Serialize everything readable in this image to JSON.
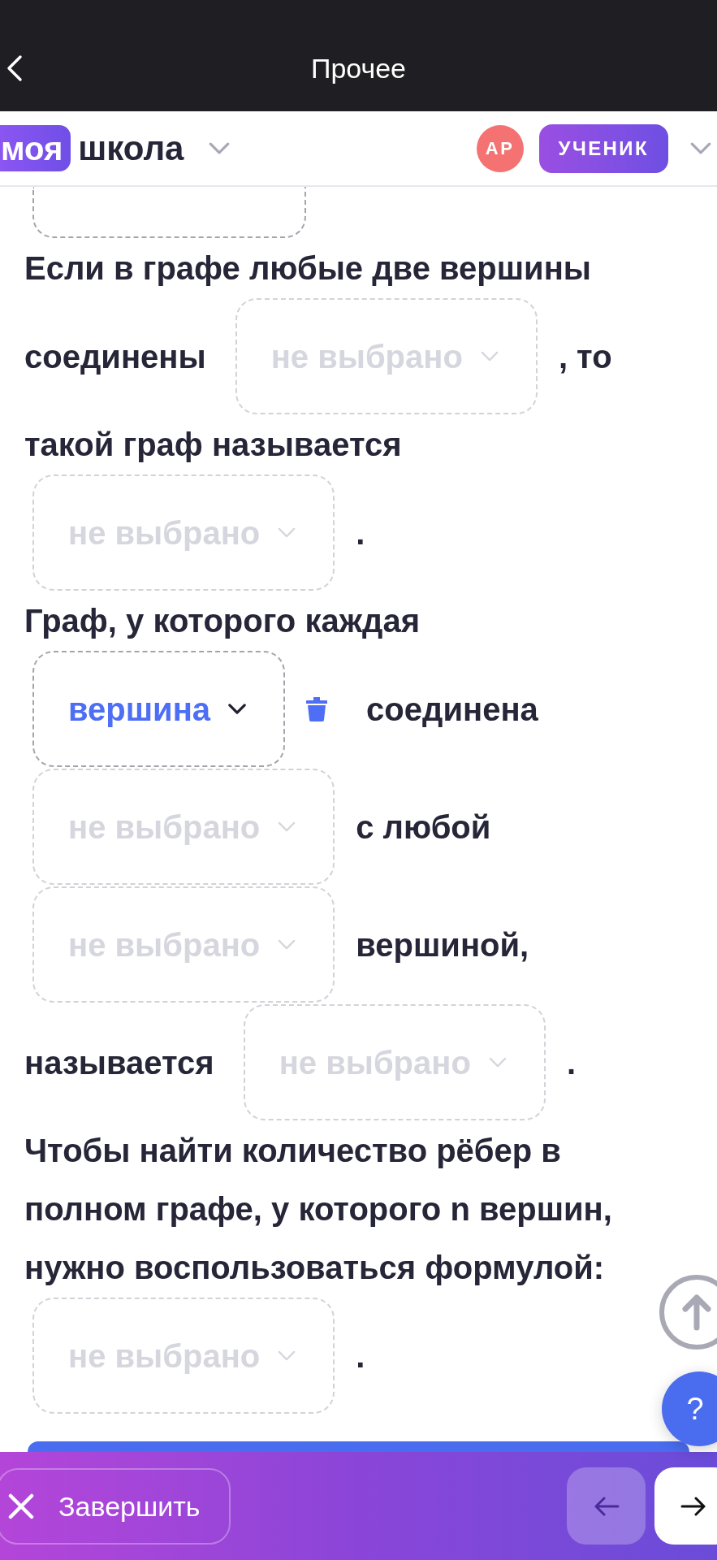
{
  "header": {
    "title": "Прочее"
  },
  "nav": {
    "logo_badge": "моя",
    "logo_text": "школа",
    "avatar": "АР",
    "role": "УЧЕНИК"
  },
  "questions": [
    {
      "rows": [
        [
          {
            "kind": "cut_dropdown"
          }
        ]
      ]
    },
    {
      "rows": [
        [
          {
            "kind": "text",
            "text": "Если в графе любые две вершины"
          }
        ],
        [
          {
            "kind": "text",
            "text": "соединены"
          },
          {
            "kind": "dropdown",
            "placeholder": "не выбрано"
          },
          {
            "kind": "text",
            "text": ", то"
          }
        ],
        [
          {
            "kind": "text",
            "text": "такой граф называется"
          }
        ],
        [
          {
            "kind": "dropdown",
            "placeholder": "не выбрано"
          },
          {
            "kind": "text",
            "text": "."
          }
        ]
      ]
    },
    {
      "rows": [
        [
          {
            "kind": "text",
            "text": "Граф, у которого каждая"
          }
        ],
        [
          {
            "kind": "dropdown",
            "value": "вершина"
          },
          {
            "kind": "text",
            "text": "соединена"
          }
        ],
        [
          {
            "kind": "dropdown",
            "placeholder": "не выбрано"
          },
          {
            "kind": "text",
            "text": "с любой"
          }
        ],
        [
          {
            "kind": "dropdown",
            "placeholder": "не выбрано"
          },
          {
            "kind": "text",
            "text": "вершиной,"
          }
        ],
        [
          {
            "kind": "text",
            "text": "называется"
          },
          {
            "kind": "dropdown",
            "placeholder": "не выбрано"
          },
          {
            "kind": "text",
            "text": "."
          }
        ]
      ]
    },
    {
      "rows": [
        [
          {
            "kind": "text",
            "text": "Чтобы найти количество рёбер в"
          }
        ],
        [
          {
            "kind": "text",
            "text": "полном графе, у которого n вершин,"
          }
        ],
        [
          {
            "kind": "text",
            "text": "нужно воспользоваться формулой:"
          }
        ],
        [
          {
            "kind": "dropdown",
            "placeholder": "не выбрано"
          },
          {
            "kind": "text",
            "text": "."
          }
        ]
      ]
    }
  ],
  "help": {
    "label": "?"
  },
  "footer": {
    "finish": "Завершить"
  }
}
